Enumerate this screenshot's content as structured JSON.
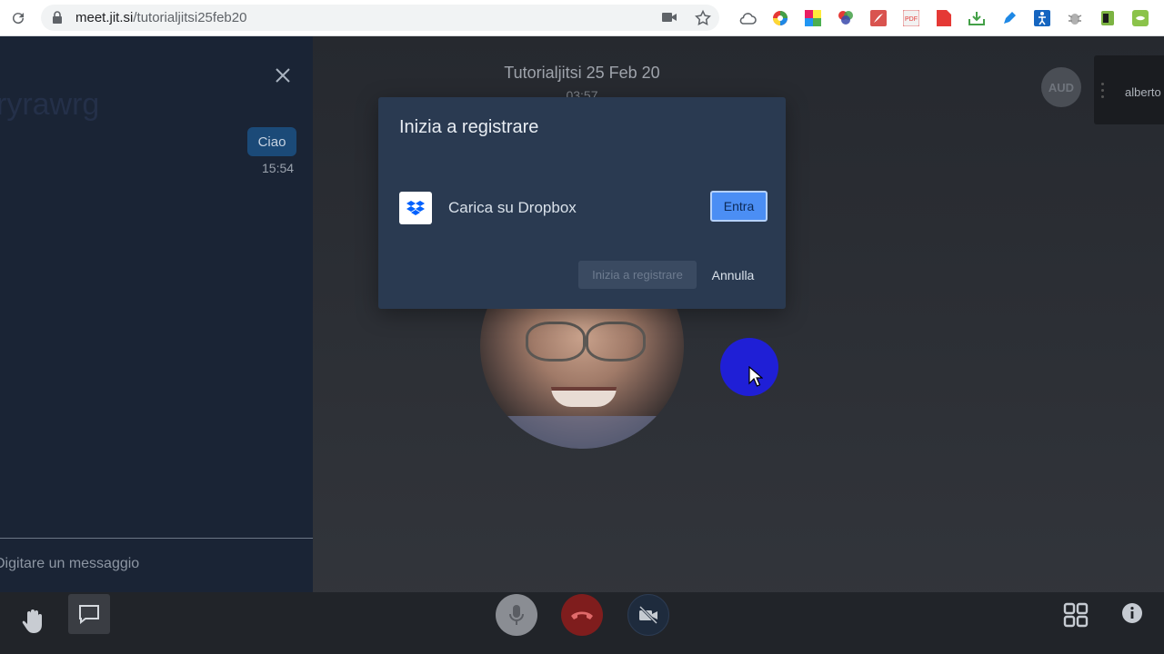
{
  "browser": {
    "url_host": "meet.jit.si",
    "url_path": "/tutorialjitsi25feb20"
  },
  "meeting": {
    "title": "Tutorialjitsi 25 Feb 20",
    "timer": "03:57",
    "remote_avatar_initials": "AUD",
    "thumbnail_name": "alberto"
  },
  "chat": {
    "ghost_text": "ryrawrg",
    "messages": [
      {
        "text": "Ciao",
        "time": "15:54"
      }
    ],
    "input_placeholder": "Digitare un messaggio"
  },
  "dialog": {
    "title": "Inizia a registrare",
    "service_label": "Carica su Dropbox",
    "signin_label": "Entra",
    "start_label": "Inizia a registrare",
    "cancel_label": "Annulla"
  },
  "toolbar": {
    "raise_hand_icon": "raise-hand-icon",
    "chat_icon": "chat-icon",
    "mic_icon": "microphone-icon",
    "hangup_icon": "hangup-icon",
    "camera_icon": "camera-off-icon",
    "tile_icon": "tile-view-icon",
    "info_icon": "info-icon"
  },
  "colors": {
    "chat_panel": "#1a2435",
    "dialog": "#2a3a51",
    "primary_button": "#4b8ef4",
    "hangup": "#7f1d1d",
    "cursor_highlight": "#1f1fd6"
  }
}
